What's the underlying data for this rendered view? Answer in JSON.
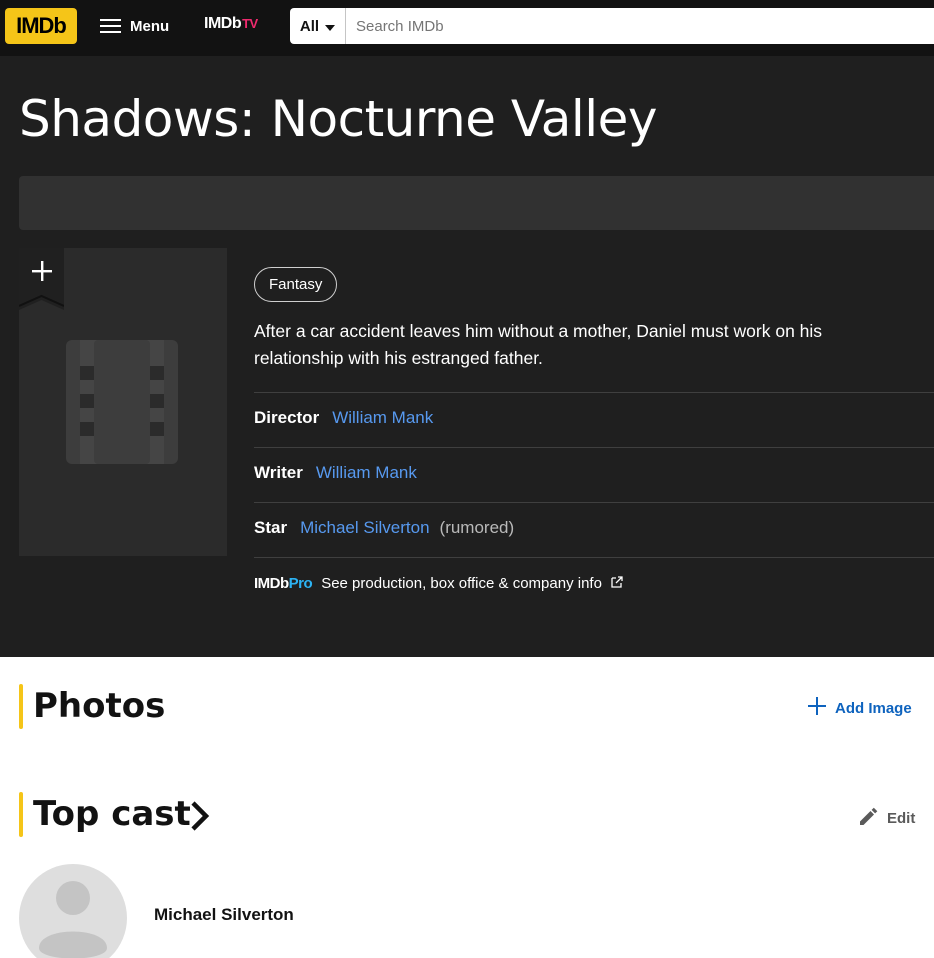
{
  "nav": {
    "logo": "IMDb",
    "menu_label": "Menu",
    "imdbtv": {
      "main": "IMDb",
      "tv": "TV"
    },
    "search": {
      "category": "All",
      "placeholder": "Search IMDb",
      "value": ""
    }
  },
  "title": {
    "name": "Shadows: Nocturne Valley",
    "genre": "Fantasy",
    "plot": "After a car accident leaves him without a mother, Daniel must work on his relationship with his estranged father.",
    "credits": [
      {
        "role": "Director",
        "name": "William Mank",
        "note": ""
      },
      {
        "role": "Writer",
        "name": "William Mank",
        "note": ""
      },
      {
        "role": "Star",
        "name": "Michael Silverton",
        "note": "(rumored)"
      }
    ],
    "pro": {
      "logo_main": "IMDb",
      "logo_pro": "Pro",
      "text": "See production, box office & company info"
    }
  },
  "photos": {
    "title": "Photos",
    "add_label": "Add Image"
  },
  "cast": {
    "title": "Top cast",
    "edit_label": "Edit",
    "members": [
      {
        "name": "Michael Silverton"
      }
    ]
  },
  "colors": {
    "accent": "#f5c518",
    "link": "#5799ef",
    "hero_bg": "#1f1f1f",
    "nav_bg": "#121212",
    "action_blue": "#0e63be"
  },
  "icons": [
    "hamburger-icon",
    "caret-down-icon",
    "plus-icon",
    "film-reel-icon",
    "external-link-icon",
    "chevron-right-icon",
    "pencil-icon",
    "avatar-icon"
  ]
}
